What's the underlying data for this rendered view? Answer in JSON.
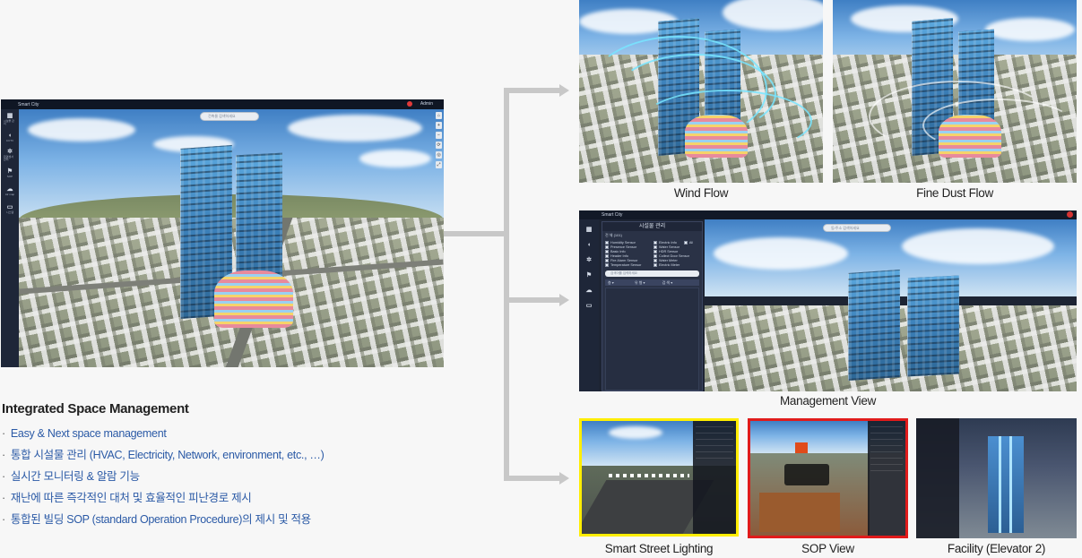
{
  "main_app": {
    "title": "Smart City",
    "admin": "Admin",
    "search_placeholder": "건축물 검색하세요",
    "sidebar": [
      {
        "icon": "building-icon",
        "label": "시설물 관리"
      },
      {
        "icon": "cctv-icon",
        "label": "CCTV"
      },
      {
        "icon": "environment-icon",
        "label": "환경센서 관리"
      },
      {
        "icon": "sop-icon",
        "label": "SOP"
      },
      {
        "icon": "cloud-icon",
        "label": "Air map"
      },
      {
        "icon": "monitor-icon",
        "label": "시스템"
      }
    ],
    "tools": [
      "⌂",
      "+",
      "−",
      "⟳",
      "◎",
      "⤢"
    ]
  },
  "description": {
    "title": "Integrated Space Management",
    "bullets": [
      "Easy & Next space management",
      "통합 시설물 관리 (HVAC, Electricity, Network, environment, etc., …)",
      "실시간 모니터링 & 알람 기능",
      "재난에 따른 즉각적인 대처 및 효율적인 피난경로 제시",
      "통합된 빌딩 SOP (standard Operation Procedure)의 제시 및 적용"
    ]
  },
  "captions": {
    "wind_flow": "Wind Flow",
    "fine_dust_flow": "Fine Dust Flow",
    "management_view": "Management View",
    "smart_street_lighting": "Smart Street Lighting",
    "sop_view": "SOP View",
    "facility": "Facility (Elevator 2)"
  },
  "management_view": {
    "title": "Smart City",
    "panel_title": "시설물 관리",
    "all_label": "전 체 (101)",
    "items": [
      "Humidity Sensor",
      "Electric Info",
      "Presence Sensor",
      "Water Sensor",
      "Basic Info",
      "HDR Sensor",
      "Header Info",
      "Collect Door Sensor",
      "Fire Alarm Sensor",
      "Water Meter",
      "Temperature Sensor",
      "Electric Meter"
    ],
    "all_checkbox": "All",
    "search_placeholder": "검색어를 입력하세요",
    "filter_labels": [
      "층",
      "유 형",
      "검 색"
    ],
    "map_search_placeholder": "동/주소 검색하세요"
  },
  "colors": {
    "arrow": "#c8c8c8",
    "bullet_text": "#2b5aa6",
    "sop_border": "#e01b1b",
    "lighting_border": "#ffee00"
  }
}
